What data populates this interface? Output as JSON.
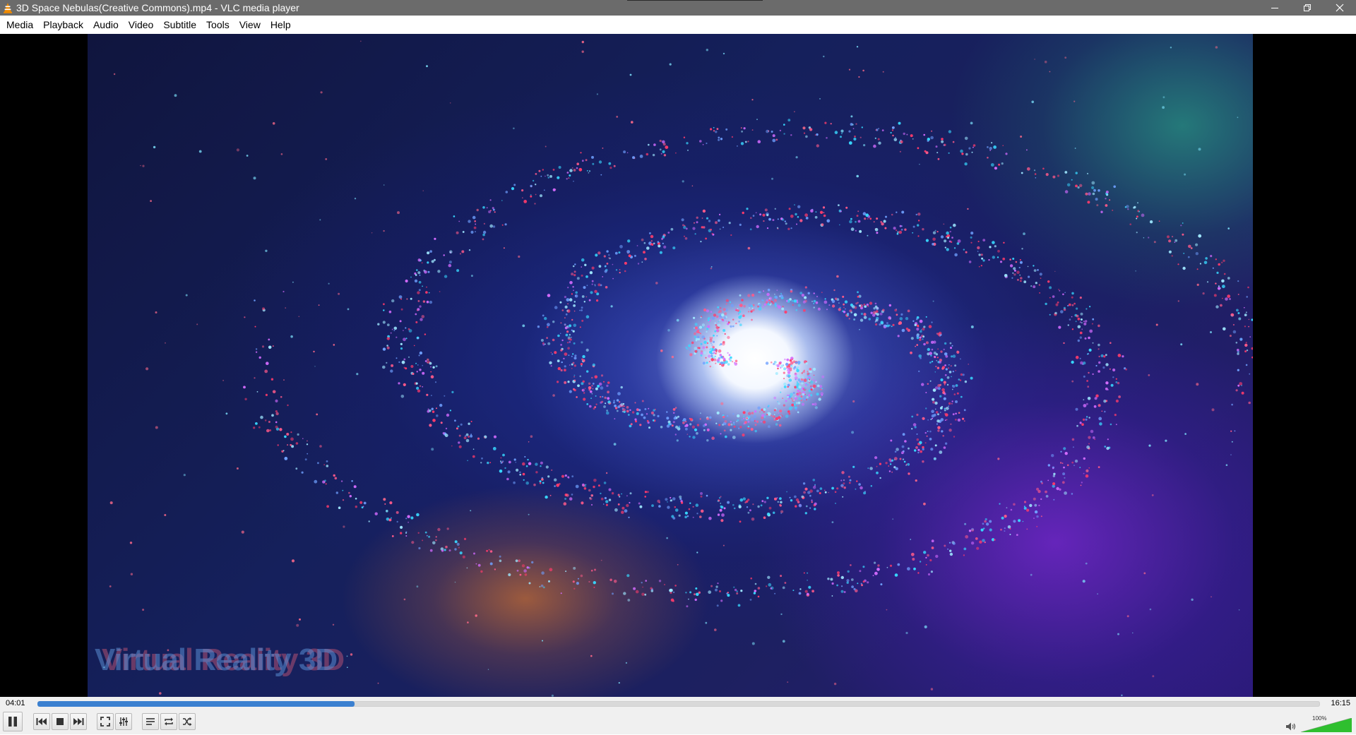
{
  "window": {
    "title": "3D Space Nebulas(Creative Commons).mp4 - VLC media player",
    "icon": "vlc-cone-icon"
  },
  "menu": [
    "Media",
    "Playback",
    "Audio",
    "Video",
    "Subtitle",
    "Tools",
    "View",
    "Help"
  ],
  "video": {
    "watermark": "Virtual Reality 3D"
  },
  "playback": {
    "elapsed": "04:01",
    "total": "16:15",
    "progress": 0.247
  },
  "volume": {
    "label": "100%",
    "level": 1.0
  },
  "icons": {
    "pause": "pause-icon",
    "previous": "previous-icon",
    "stop": "stop-icon",
    "next": "next-icon",
    "fullscreen": "fullscreen-icon",
    "extended_settings": "equalizer-icon",
    "playlist": "playlist-icon",
    "loop": "loop-icon",
    "shuffle": "shuffle-icon",
    "mute": "speaker-icon"
  },
  "colors": {
    "titlebar": "#6b6b6b",
    "seek_fill": "#3b80d0",
    "volume_fill": "#2fbf2f",
    "vlc_orange": "#f08a00"
  }
}
